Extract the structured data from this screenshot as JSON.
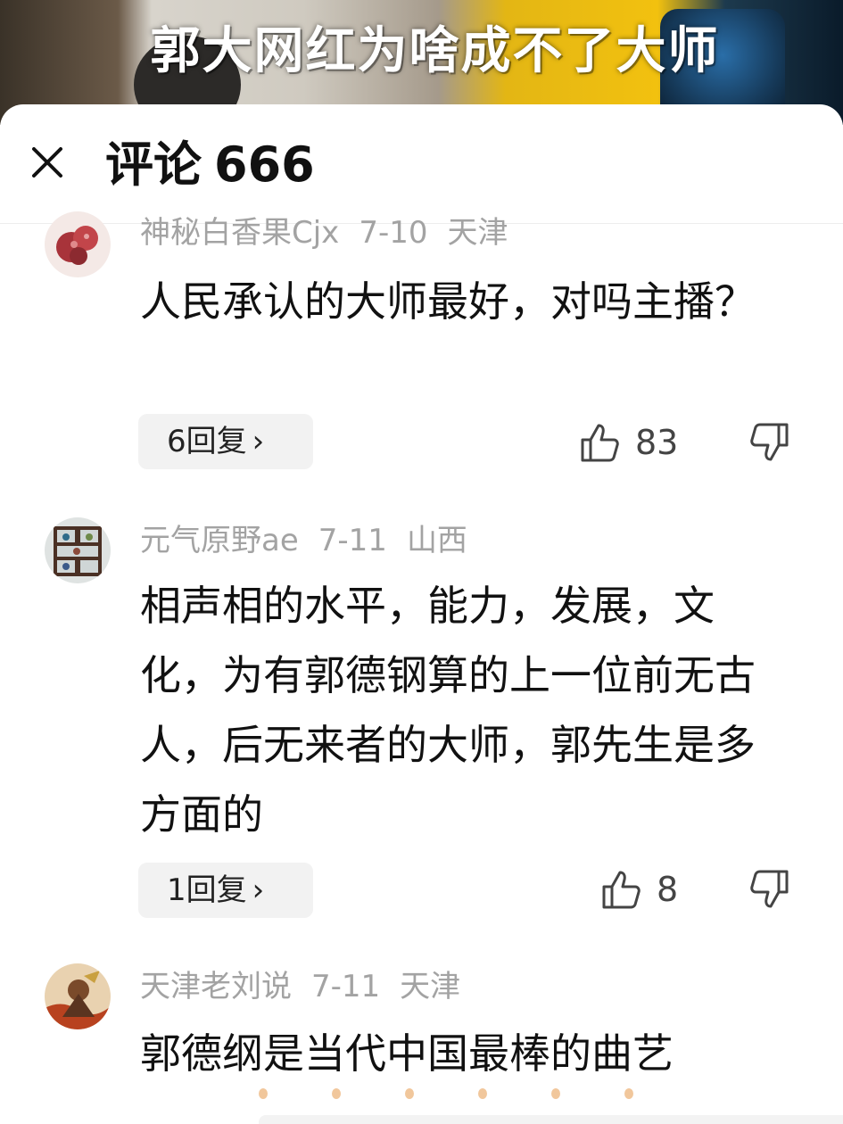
{
  "video": {
    "caption": "郭大网红为啥成不了大师"
  },
  "header": {
    "title_label": "评论",
    "comment_count": "666"
  },
  "comments": [
    {
      "username": "神秘白香果Cjx",
      "date": "7-10",
      "location": "天津",
      "text": "人民承认的大师最好，对吗主播？",
      "reply_label": "6回复",
      "like_count": "83",
      "avatar_icon": "red-flower-avatar-icon"
    },
    {
      "username": "元气原野ae",
      "date": "7-11",
      "location": "山西",
      "text": "相声相的水平，能力，发展，文化，为有郭德钢算的上一位前无古人，后无来者的大师，郭先生是多方面的",
      "reply_label": "1回复",
      "like_count": "8",
      "avatar_icon": "shelf-avatar-icon"
    },
    {
      "username": "天津老刘说",
      "date": "7-11",
      "location": "天津",
      "text": "郭德纲是当代中国最棒的曲艺",
      "avatar_icon": "warrior-avatar-icon"
    }
  ],
  "icons": {
    "close": "close-icon",
    "like": "thumbs-up-icon",
    "dislike": "thumbs-down-icon",
    "reply_chevron": "chevron-right-icon"
  },
  "colors": {
    "meta_text": "#a3a3a3",
    "body_text": "#111111",
    "pill_bg": "#f2f2f2"
  }
}
